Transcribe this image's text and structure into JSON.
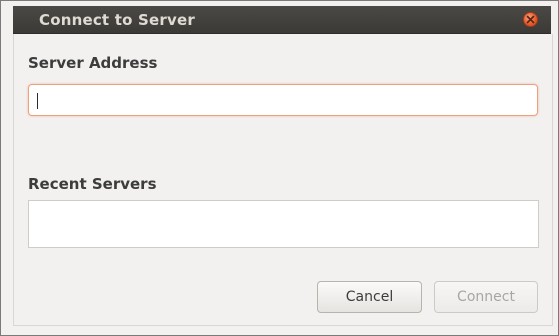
{
  "window": {
    "title": "Connect to Server",
    "close_icon": "close-icon"
  },
  "server_address": {
    "label": "Server Address",
    "value": "",
    "placeholder": ""
  },
  "recent_servers": {
    "label": "Recent Servers",
    "items": []
  },
  "buttons": {
    "cancel_label": "Cancel",
    "connect_label": "Connect",
    "connect_enabled": false
  },
  "colors": {
    "titlebar": "#3c3b37",
    "title_text": "#dfdbd2",
    "close_button": "#e2582b",
    "focus_border": "#f0a07e",
    "window_background": "#f2f1f0"
  }
}
